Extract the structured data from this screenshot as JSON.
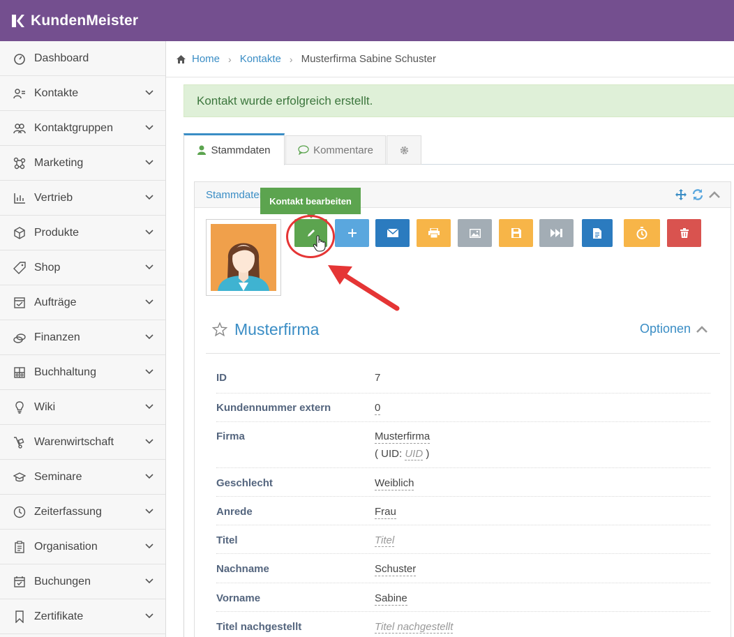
{
  "app": {
    "name": "KundenMeister"
  },
  "sidebar": {
    "items": [
      {
        "label": "Dashboard",
        "icon": "dashboard-icon",
        "expandable": false
      },
      {
        "label": "Kontakte",
        "icon": "contacts-icon",
        "expandable": true
      },
      {
        "label": "Kontaktgruppen",
        "icon": "groups-icon",
        "expandable": true
      },
      {
        "label": "Marketing",
        "icon": "marketing-icon",
        "expandable": true
      },
      {
        "label": "Vertrieb",
        "icon": "chart-icon",
        "expandable": true
      },
      {
        "label": "Produkte",
        "icon": "box-icon",
        "expandable": true
      },
      {
        "label": "Shop",
        "icon": "tag-icon",
        "expandable": true
      },
      {
        "label": "Aufträge",
        "icon": "orders-icon",
        "expandable": true
      },
      {
        "label": "Finanzen",
        "icon": "coins-icon",
        "expandable": true
      },
      {
        "label": "Buchhaltung",
        "icon": "ledger-icon",
        "expandable": true
      },
      {
        "label": "Wiki",
        "icon": "bulb-icon",
        "expandable": true
      },
      {
        "label": "Warenwirtschaft",
        "icon": "handtruck-icon",
        "expandable": true
      },
      {
        "label": "Seminare",
        "icon": "graduation-cap-icon",
        "expandable": true
      },
      {
        "label": "Zeiterfassung",
        "icon": "clock-icon",
        "expandable": true
      },
      {
        "label": "Organisation",
        "icon": "clipboard-icon",
        "expandable": true
      },
      {
        "label": "Buchungen",
        "icon": "calendar-icon",
        "expandable": true
      },
      {
        "label": "Zertifikate",
        "icon": "bookmark-icon",
        "expandable": true
      }
    ]
  },
  "breadcrumb": {
    "home": "Home",
    "contacts": "Kontakte",
    "current": "Musterfirma Sabine Schuster"
  },
  "alert": {
    "message": "Kontakt wurde erfolgreich erstellt."
  },
  "tabs": {
    "stammdaten": "Stammdaten",
    "kommentare": "Kommentare"
  },
  "panel": {
    "title": "Stammdaten"
  },
  "tooltip": {
    "text": "Kontakt bearbeiten"
  },
  "toolbar": {
    "buttons": [
      {
        "name": "edit-button",
        "icon": "pencil-icon",
        "color": "#5ca44f"
      },
      {
        "name": "add-button",
        "icon": "plus-icon",
        "color": "#5aa7de"
      },
      {
        "name": "email-button",
        "icon": "envelope-icon",
        "color": "#2b7bbf"
      },
      {
        "name": "print-button",
        "icon": "print-icon",
        "color": "#f7b548"
      },
      {
        "name": "image-button",
        "icon": "image-icon",
        "color": "#a3adb5"
      },
      {
        "name": "save-button",
        "icon": "save-icon",
        "color": "#f7b548"
      },
      {
        "name": "next-button",
        "icon": "fast-forward-icon",
        "color": "#a3adb5"
      },
      {
        "name": "document-button",
        "icon": "document-icon",
        "color": "#2b7bbf"
      },
      {
        "name": "stopwatch-button",
        "icon": "stopwatch-icon",
        "color": "#f7b548"
      },
      {
        "name": "delete-button",
        "icon": "trash-icon",
        "color": "#d9534f"
      }
    ]
  },
  "contact": {
    "company": "Musterfirma",
    "options_label": "Optionen",
    "fields": [
      {
        "label": "ID",
        "value": "7",
        "empty": false
      },
      {
        "label": "Kundennummer extern",
        "value": "0",
        "empty": false
      },
      {
        "label": "Firma",
        "value": "Musterfirma",
        "empty": false,
        "uid_prefix": "( UID: ",
        "uid_value": "UID",
        "uid_suffix": " )"
      },
      {
        "label": "Geschlecht",
        "value": "Weiblich",
        "empty": false
      },
      {
        "label": "Anrede",
        "value": "Frau",
        "empty": false
      },
      {
        "label": "Titel",
        "value": "Titel",
        "empty": true
      },
      {
        "label": "Nachname",
        "value": "Schuster",
        "empty": false
      },
      {
        "label": "Vorname",
        "value": "Sabine",
        "empty": false
      },
      {
        "label": "Titel nachgestellt",
        "value": "Titel nachgestellt",
        "empty": true
      }
    ]
  },
  "colors": {
    "brand": "#744f8f",
    "link": "#3a8dc5",
    "success": "#5ca44f",
    "danger": "#d9534f"
  }
}
